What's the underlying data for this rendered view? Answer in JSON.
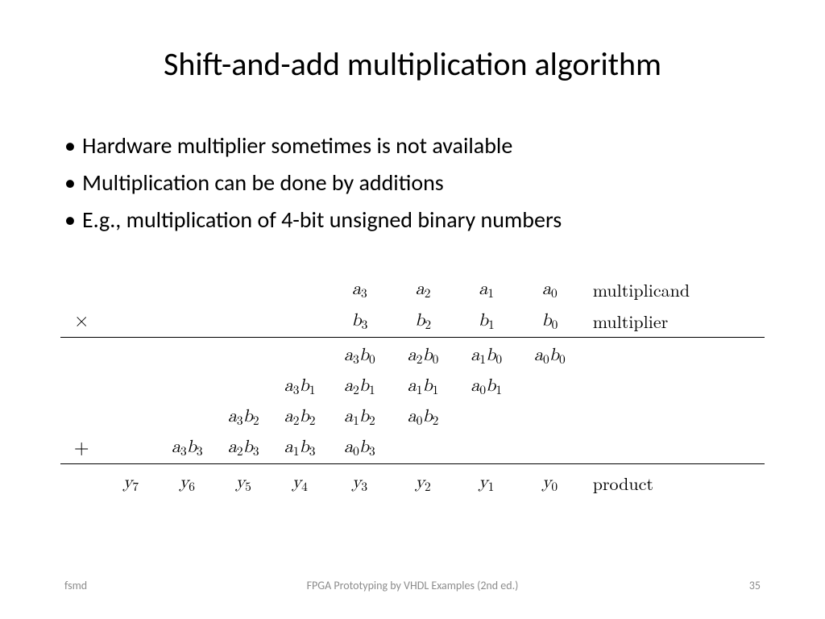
{
  "title": "Shift-and-add multiplication algorithm",
  "bullets": [
    "Hardware multiplier sometimes is not available",
    "Multiplication can be done by additions",
    "E.g., multiplication of 4-bit unsigned binary numbers"
  ],
  "table": {
    "op_mul": "×",
    "op_add": "+",
    "row_a": {
      "c4": "a₃",
      "c5": "a₂",
      "c6": "a₁",
      "c7": "a₀",
      "label": "multiplicand"
    },
    "row_b": {
      "c4": "b₃",
      "c5": "b₂",
      "c6": "b₁",
      "c7": "b₀",
      "label": "multiplier"
    },
    "pp0": {
      "c4": "a₃b₀",
      "c5": "a₂b₀",
      "c6": "a₁b₀",
      "c7": "a₀b₀"
    },
    "pp1": {
      "c3": "a₃b₁",
      "c4": "a₂b₁",
      "c5": "a₁b₁",
      "c6": "a₀b₁"
    },
    "pp2": {
      "c2": "a₃b₂",
      "c3": "a₂b₂",
      "c4": "a₁b₂",
      "c5": "a₀b₂"
    },
    "pp3": {
      "c1": "a₃b₃",
      "c2": "a₂b₃",
      "c3": "a₁b₃",
      "c4": "a₀b₃"
    },
    "result": {
      "c0": "y₇",
      "c1": "y₆",
      "c2": "y₅",
      "c3": "y₄",
      "c4": "y₃",
      "c5": "y₂",
      "c6": "y₁",
      "c7": "y₀",
      "label": "product"
    }
  },
  "footer": {
    "left": "fsmd",
    "center": "FPGA Prototyping by VHDL Examples (2nd ed.)",
    "right": "35"
  }
}
